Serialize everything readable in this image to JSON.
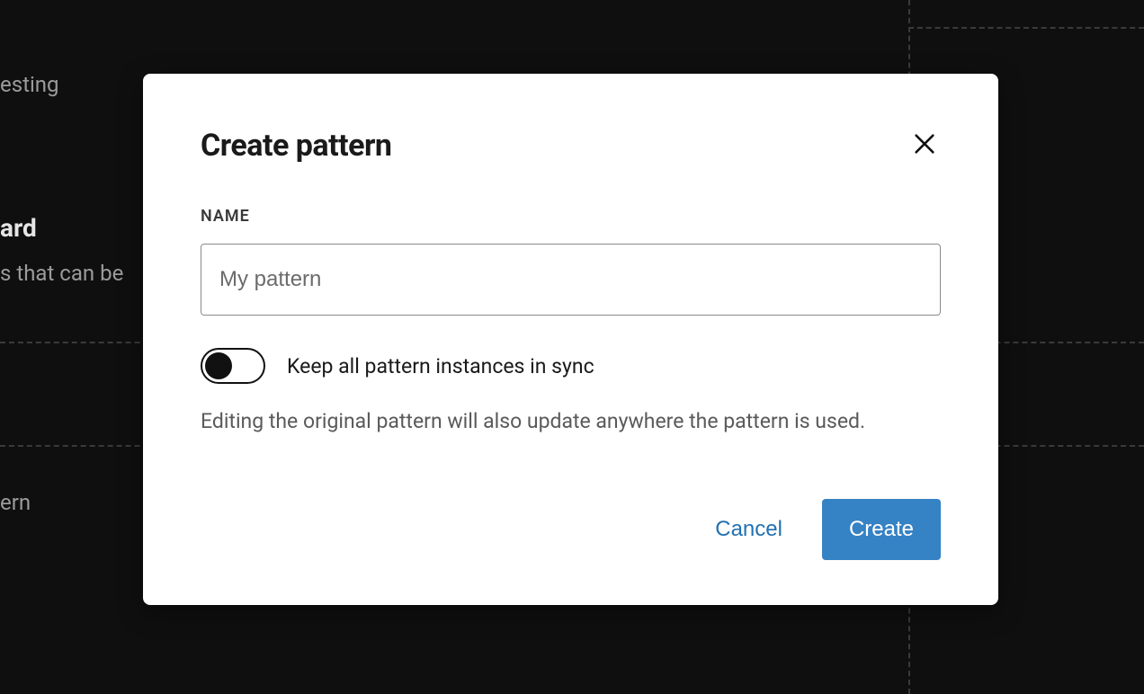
{
  "background": {
    "text1": "esting",
    "heading1": "ard",
    "text2": "s that can be",
    "text3": "ern"
  },
  "modal": {
    "title": "Create pattern",
    "name_label": "NAME",
    "name_placeholder": "My pattern",
    "name_value": "",
    "sync_toggle_label": "Keep all pattern instances in sync",
    "sync_toggle_on": false,
    "help_text": "Editing the original pattern will also update anywhere the pattern is used.",
    "cancel_label": "Cancel",
    "create_label": "Create"
  }
}
